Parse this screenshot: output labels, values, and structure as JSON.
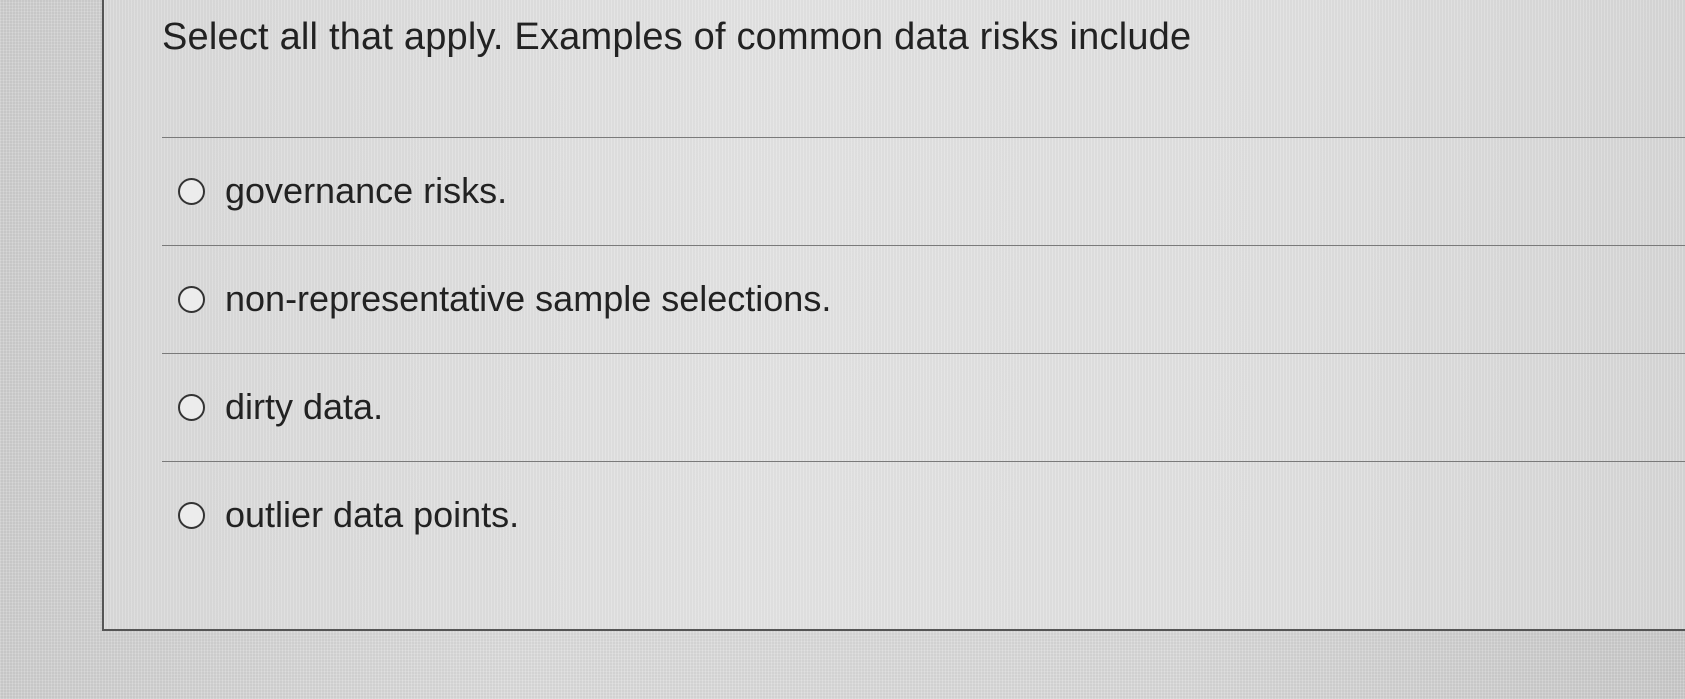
{
  "question": {
    "text": "Select all that apply. Examples of common data risks include"
  },
  "options": [
    {
      "label": "governance risks.",
      "selected": false
    },
    {
      "label": "non-representative sample selections.",
      "selected": false
    },
    {
      "label": "dirty data.",
      "selected": false
    },
    {
      "label": "outlier data points.",
      "selected": false
    }
  ]
}
